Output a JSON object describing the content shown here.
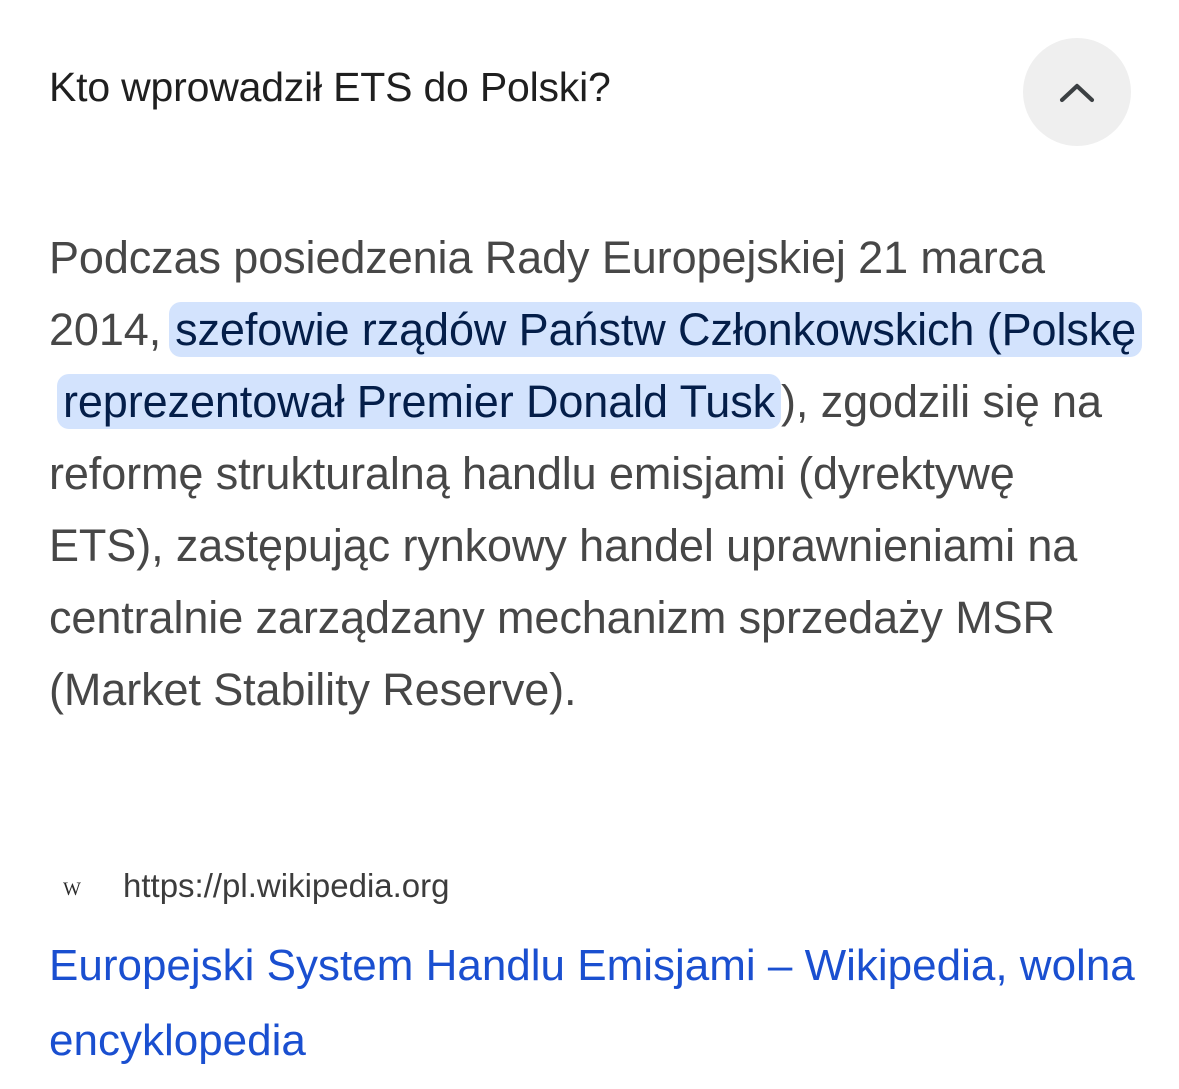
{
  "question": {
    "text": "Kto wprowadził ETS do Polski?",
    "collapse_icon": "chevron-up-icon"
  },
  "answer": {
    "before": "Podczas posiedzenia Rady Europejskiej 21 marca 2014,",
    "highlight": "szefowie rządów Państw Członkowskich (Polskę reprezentował Premier Donald Tusk",
    "after": "), zgodzili się na reformę strukturalną handlu emisjami (dyrektywę ETS), zastępując rynkowy handel uprawnieniami na centralnie zarządzany mechanizm sprzedaży MSR (Market Stability Reserve)."
  },
  "source": {
    "favicon_letter": "W",
    "favicon_icon": "wikipedia-icon",
    "url": "https://pl.wikipedia.org",
    "title": "Europejski System Handlu Emisjami – Wikipedia, wolna encyklopedia"
  },
  "colors": {
    "highlight_bg": "#d3e3fd",
    "highlight_text": "#041e49",
    "link": "#1a4fd0",
    "body_text": "#474747"
  }
}
